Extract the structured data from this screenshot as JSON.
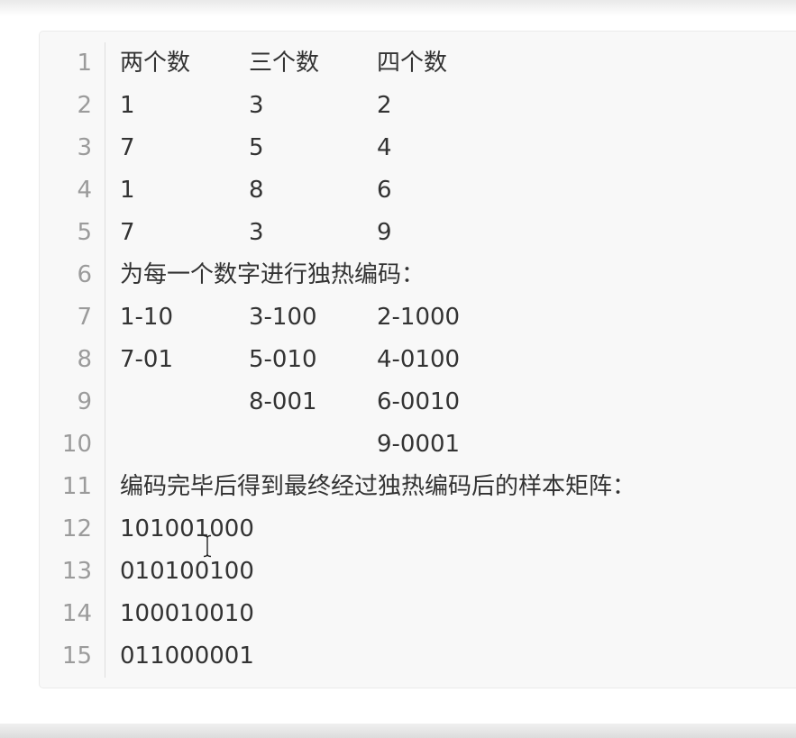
{
  "editor": {
    "lines": [
      {
        "num": "1",
        "cells": [
          "两个数",
          "三个数",
          "四个数"
        ]
      },
      {
        "num": "2",
        "cells": [
          "1",
          "3",
          "2"
        ]
      },
      {
        "num": "3",
        "cells": [
          "7",
          "5",
          "4"
        ]
      },
      {
        "num": "4",
        "cells": [
          "1",
          "8",
          "6"
        ]
      },
      {
        "num": "5",
        "cells": [
          "7",
          "3",
          "9"
        ]
      },
      {
        "num": "6",
        "cells": [
          "为每一个数字进行独热编码：",
          "",
          ""
        ]
      },
      {
        "num": "7",
        "cells": [
          "1-10",
          "3-100",
          "2-1000"
        ]
      },
      {
        "num": "8",
        "cells": [
          "7-01",
          "5-010",
          "4-0100"
        ]
      },
      {
        "num": "9",
        "cells": [
          "",
          "8-001",
          "6-0010"
        ]
      },
      {
        "num": "10",
        "cells": [
          "",
          "",
          "9-0001"
        ]
      },
      {
        "num": "11",
        "cells": [
          "编码完毕后得到最终经过独热编码后的样本矩阵：",
          "",
          ""
        ]
      },
      {
        "num": "12",
        "cells": [
          "101001000",
          "",
          ""
        ]
      },
      {
        "num": "13",
        "cells": [
          "010100100",
          "",
          ""
        ]
      },
      {
        "num": "14",
        "cells": [
          "100010010",
          "",
          ""
        ]
      },
      {
        "num": "15",
        "cells": [
          "011000001",
          "",
          ""
        ]
      }
    ]
  },
  "cursor": {
    "icon": "text-cursor-icon"
  },
  "colors": {
    "panel_bg": "#f8f8f8",
    "line_number": "#9b9b9b",
    "text": "#333333"
  }
}
